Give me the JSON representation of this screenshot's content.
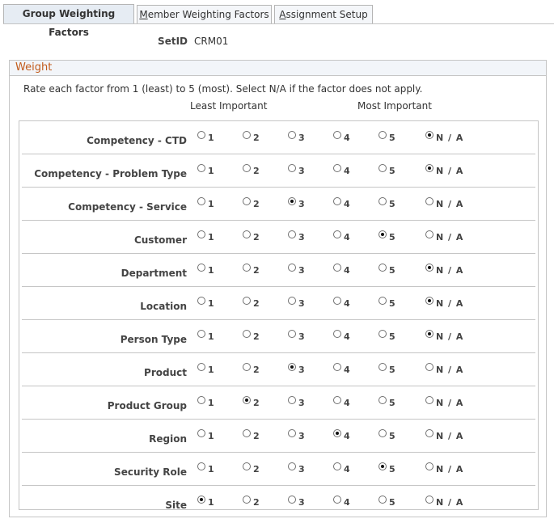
{
  "tabs": [
    {
      "label": "Group Weighting Factors",
      "active": true
    },
    {
      "label": "Member Weighting Factors",
      "active": false,
      "underline_char": "M"
    },
    {
      "label": "Assignment Setup",
      "active": false,
      "underline_char": "A"
    }
  ],
  "setid": {
    "label": "SetID",
    "value": "CRM01"
  },
  "weight": {
    "title": "Weight",
    "instructions": "Rate each factor from 1 (least) to 5 (most). Select N/A if the factor does not apply.",
    "least_label": "Least Important",
    "most_label": "Most Important",
    "options": [
      "1",
      "2",
      "3",
      "4",
      "5",
      "N / A"
    ],
    "factors": [
      {
        "name": "Competency - CTD",
        "selected": "N / A"
      },
      {
        "name": "Competency - Problem Type",
        "selected": "N / A"
      },
      {
        "name": "Competency - Service",
        "selected": "3"
      },
      {
        "name": "Customer",
        "selected": "5"
      },
      {
        "name": "Department",
        "selected": "N / A"
      },
      {
        "name": "Location",
        "selected": "N / A"
      },
      {
        "name": "Person Type",
        "selected": "N / A"
      },
      {
        "name": "Product",
        "selected": "3"
      },
      {
        "name": "Product Group",
        "selected": "2"
      },
      {
        "name": "Region",
        "selected": "4"
      },
      {
        "name": "Security Role",
        "selected": "5"
      },
      {
        "name": "Site",
        "selected": "1"
      }
    ]
  },
  "colors": {
    "header_text": "#c25b1c",
    "border": "#c5c5c5"
  }
}
